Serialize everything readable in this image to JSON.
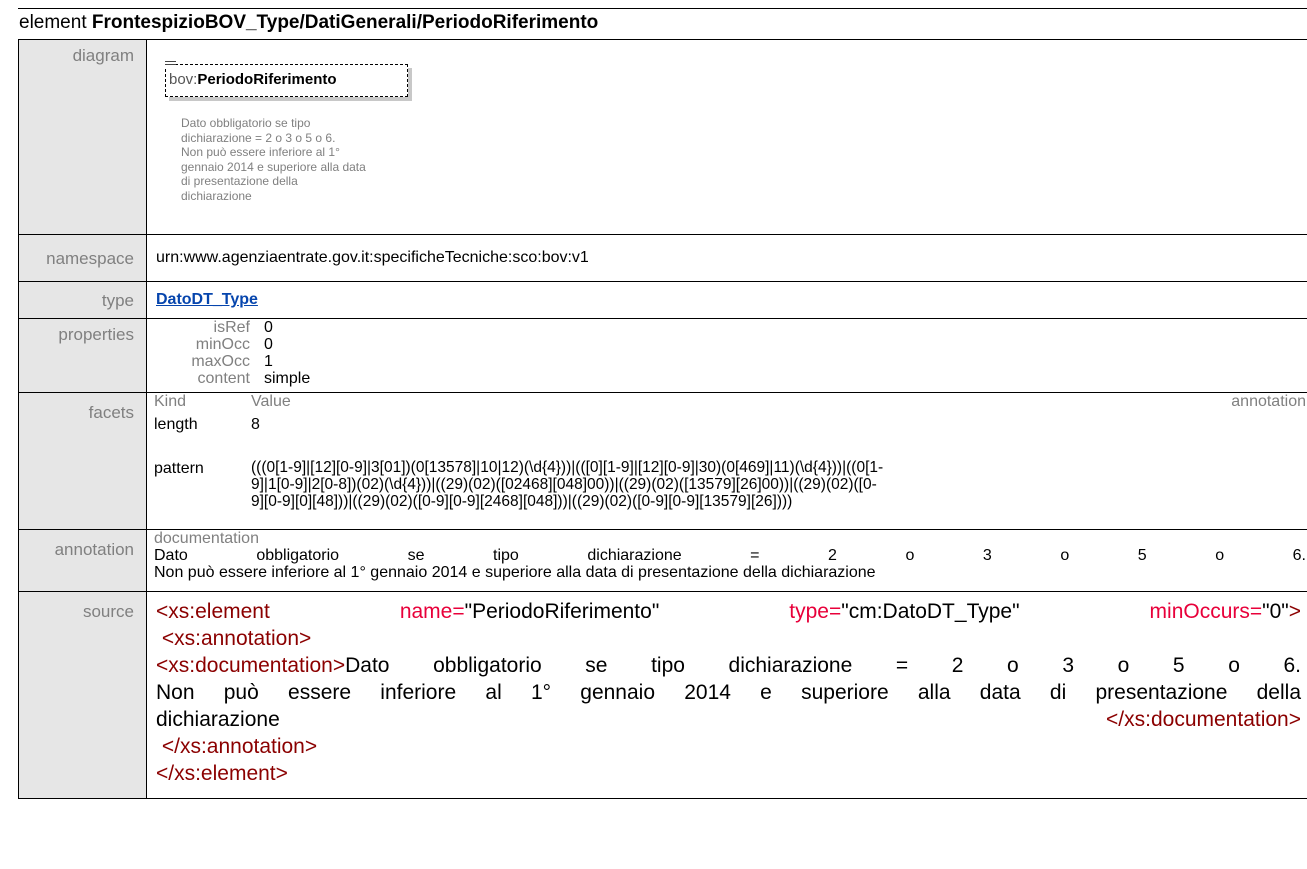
{
  "title": {
    "prefix": "element ",
    "name": "FrontespizioBOV_Type/DatiGenerali/PeriodoRiferimento"
  },
  "rows": {
    "diagram": {
      "label": "diagram",
      "box_prefix": "bov:",
      "box_name": "PeriodoRiferimento",
      "note_lines": [
        "Dato obbligatorio se tipo",
        "dichiarazione = 2 o 3 o 5 o 6.",
        "Non può essere inferiore al 1°",
        "gennaio 2014 e superiore alla data",
        "di presentazione della",
        "dichiarazione"
      ]
    },
    "namespace": {
      "label": "namespace",
      "value": "urn:www.agenziaentrate.gov.it:specificheTecniche:sco:bov:v1"
    },
    "type": {
      "label": "type",
      "value": "DatoDT_Type"
    },
    "properties": {
      "label": "properties",
      "items": [
        {
          "key": "isRef",
          "value": "0"
        },
        {
          "key": "minOcc",
          "value": "0"
        },
        {
          "key": "maxOcc",
          "value": "1"
        },
        {
          "key": "content",
          "value": "simple"
        }
      ]
    },
    "facets": {
      "label": "facets",
      "header_kind": "Kind",
      "header_value": "Value",
      "header_annotation": "annotation",
      "length_kind": "length",
      "length_value": "8",
      "pattern_kind": "pattern",
      "pattern_lines": [
        "(((0[1-9]|[12][0-9]|3[01])(0[13578]|10|12)(\\d{4}))|(([0][1-9]|[12][0-9]|30)(0[469]|11)(\\d{4}))|((0[1-",
        "9]|1[0-9]|2[0-8])(02)(\\d{4}))|((29)(02)([02468][048]00))|((29)(02)([13579][26]00))|((29)(02)([0-",
        "9][0-9][0][48]))|((29)(02)([0-9][0-9][2468][048]))|((29)(02)([0-9][0-9][13579][26])))"
      ]
    },
    "annotation": {
      "label": "annotation",
      "header": "documentation",
      "line1": "Dato obbligatorio se tipo dichiarazione = 2 o 3 o 5 o 6.",
      "line2": "Non può essere inferiore al 1° gennaio 2014 e superiore alla data di presentazione della dichiarazione"
    },
    "source": {
      "label": "source",
      "el_open": "<xs:element",
      "attr_name": "name=",
      "attr_name_val": "\"PeriodoRiferimento\"",
      "attr_type": "type=",
      "attr_type_val": "\"cm:DatoDT_Type\"",
      "attr_min": "minOccurs=",
      "attr_min_val": "\"0\"",
      "gt": ">",
      "ann_open": "<xs:annotation>",
      "doc_open": "<xs:documentation>",
      "doc_text_1": "Dato obbligatorio se tipo dichiarazione = 2 o 3 o 5 o 6.",
      "doc_text_2": "Non può essere inferiore al 1° gennaio 2014 e superiore alla data di presentazione della",
      "doc_text_3": "dichiarazione",
      "doc_close": "</xs:documentation>",
      "ann_close": "</xs:annotation>",
      "el_close": "</xs:element>"
    }
  }
}
